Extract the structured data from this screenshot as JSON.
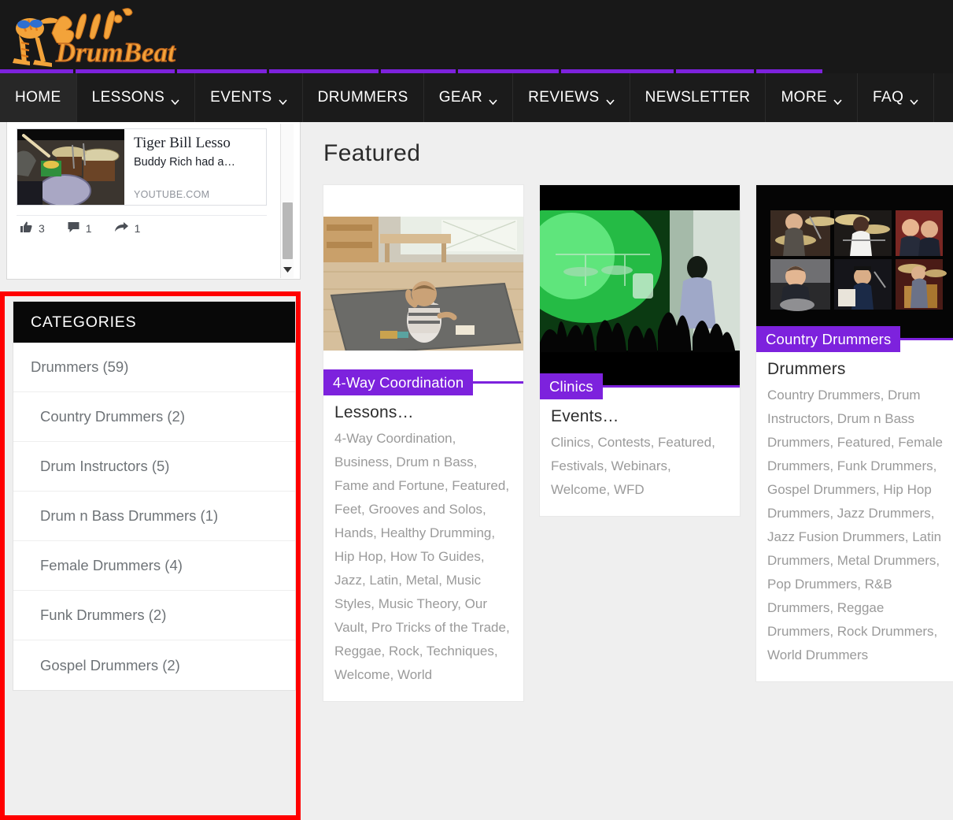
{
  "header": {
    "logo_text_1": "Bill's",
    "logo_text_2": "DrumBeat",
    "nav": [
      {
        "label": "HOME",
        "has_caret": false,
        "active": true
      },
      {
        "label": "LESSONS",
        "has_caret": true,
        "active": false
      },
      {
        "label": "EVENTS",
        "has_caret": true,
        "active": false
      },
      {
        "label": "DRUMMERS",
        "has_caret": false,
        "active": false
      },
      {
        "label": "GEAR",
        "has_caret": true,
        "active": false
      },
      {
        "label": "REVIEWS",
        "has_caret": true,
        "active": false
      },
      {
        "label": "NEWSLETTER",
        "has_caret": false,
        "active": false
      },
      {
        "label": "MORE",
        "has_caret": true,
        "active": false
      },
      {
        "label": "FAQ",
        "has_caret": true,
        "active": false
      }
    ],
    "search_icon": "search-icon",
    "accent_color": "#7d22dd"
  },
  "sidebar": {
    "facebook_post": {
      "link_title": "Tiger Bill Lesso",
      "link_desc": "Buddy Rich had a…",
      "link_domain": "YOUTUBE.COM",
      "likes": "3",
      "comments": "1",
      "shares": "1",
      "like_icon": "thumbs-up-icon",
      "comment_icon": "comment-bubble-icon",
      "share_icon": "share-arrow-icon",
      "scroll_down_icon": "chevron-down-icon"
    },
    "categories": {
      "title": "CATEGORIES",
      "items": [
        {
          "label": "Drummers (59)",
          "sub": false
        },
        {
          "label": "Country Drummers (2)",
          "sub": true
        },
        {
          "label": "Drum Instructors (5)",
          "sub": true
        },
        {
          "label": "Drum n Bass Drummers (1)",
          "sub": true
        },
        {
          "label": "Female Drummers (4)",
          "sub": true
        },
        {
          "label": "Funk Drummers (2)",
          "sub": true
        },
        {
          "label": "Gospel Drummers (2)",
          "sub": true
        }
      ],
      "highlight_color": "#ff0000"
    }
  },
  "main": {
    "heading": "Featured",
    "cards": [
      {
        "badge": "4-Way Coordination",
        "title": "Lessons…",
        "tags": "4-Way Coordination, Business, Drum n Bass, Fame and Fortune, Featured, Feet, Grooves and Solos, Hands, Healthy Drumming, Hip Hop, How To Guides, Jazz, Latin, Metal, Music Styles, Music Theory, Our Vault, Pro Tricks of the Trade, Reggae, Rock, Techniques, Welcome, World",
        "image": "baby-on-rug-living-room"
      },
      {
        "badge": "Clinics",
        "title": "Events…",
        "tags": "Clinics, Contests, Featured, Festivals, Webinars, Welcome, WFD",
        "image": "green-lit-concert-crowd"
      },
      {
        "badge": "Country Drummers",
        "title": "Drummers",
        "tags": "Country Drummers, Drum Instructors, Drum n Bass Drummers, Featured, Female Drummers, Funk Drummers, Gospel Drummers, Hip Hop Drummers, Jazz Drummers, Jazz Fusion Drummers, Latin Drummers, Metal Drummers, Pop Drummers, R&B Drummers, Reggae Drummers, Rock Drummers, World Drummers",
        "image": "drummer-photo-collage"
      }
    ]
  }
}
